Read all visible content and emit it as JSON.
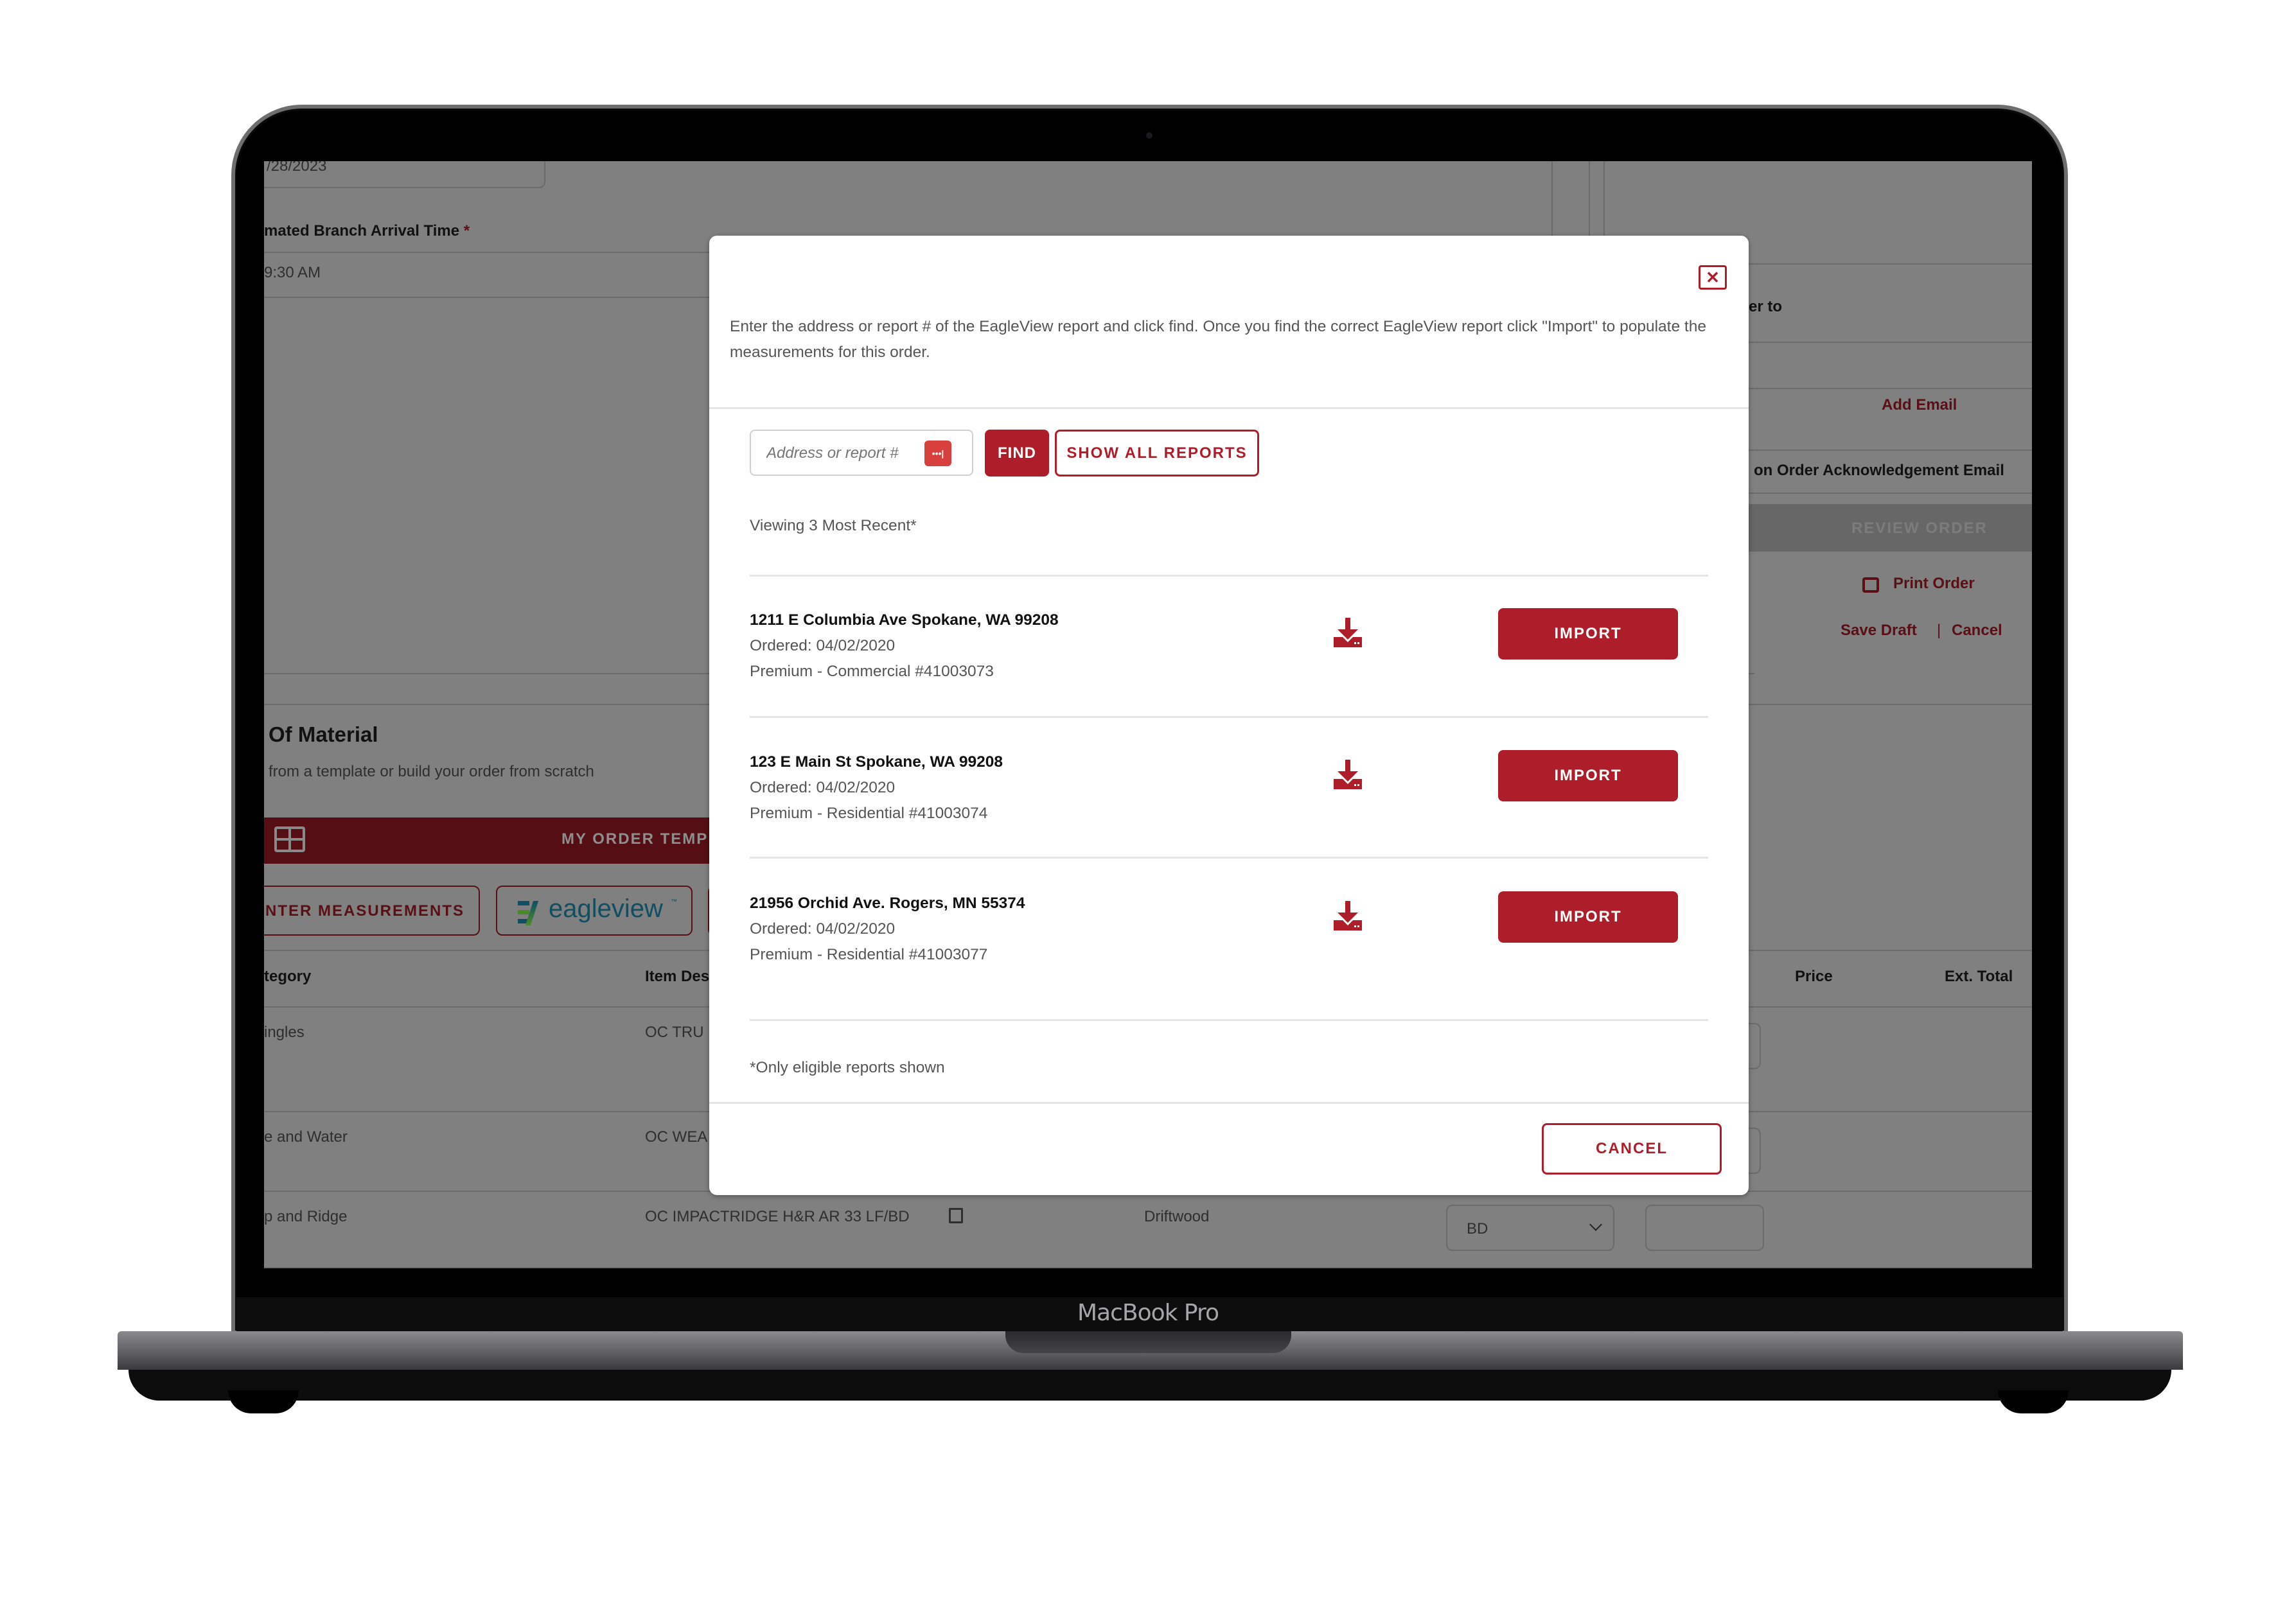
{
  "device": {
    "brand_label": "MacBook Pro"
  },
  "background_page": {
    "date_field_value": "/28/2023",
    "arrival_time_label": "mated Branch Arrival Time",
    "required_marker": "*",
    "arrival_time_value": "9:30 AM",
    "section_title": "Of Material",
    "section_subtitle": "from a template or build your order from scratch",
    "template_bar_label": "MY ORDER TEMP",
    "enter_measurements_label": "NTER MEASUREMENTS",
    "eagleview_logo_text": "eagleview",
    "eagleview_tm": "™",
    "table_headers": {
      "category": "tegory",
      "item_description": "Item Des",
      "price": "Price",
      "ext_total": "Ext. Total"
    },
    "table_rows": [
      {
        "category": "ingles",
        "item": "OC TRU"
      },
      {
        "category": "e and Water",
        "item": "OC WEA"
      },
      {
        "category": "p and Ridge",
        "item": "OC IMPACTRIDGE H&R AR 33 LF/BD",
        "color": "Driftwood",
        "uom": "BD"
      }
    ],
    "right_panel": {
      "order_to_label": "er to",
      "add_email_link": "Add Email",
      "ack_email_label": "on Order Acknowledgement Email",
      "review_order_button": "REVIEW ORDER",
      "print_order_link": "Print Order",
      "save_draft_link": "Save Draft",
      "link_separator": "|",
      "cancel_link": "Cancel"
    }
  },
  "modal": {
    "instructions": "Enter the address or report # of the EagleView report and click find.  Once you find the correct EagleView report click \"Import\" to populate the measurements for this order.",
    "search": {
      "placeholder": "Address or report #",
      "value": ""
    },
    "find_button": "FIND",
    "show_all_button": "SHOW ALL REPORTS",
    "viewing_label": "Viewing 3 Most Recent*",
    "reports": [
      {
        "address": "1211 E Columbia Ave Spokane, WA 99208",
        "ordered": "Ordered: 04/02/2020",
        "product": "Premium - Commercial #41003073",
        "import_label": "IMPORT"
      },
      {
        "address": "123 E Main St Spokane, WA 99208",
        "ordered": "Ordered: 04/02/2020",
        "product": "Premium - Residential #41003074",
        "import_label": "IMPORT"
      },
      {
        "address": "21956 Orchid Ave. Rogers, MN 55374",
        "ordered": "Ordered: 04/02/2020",
        "product": "Premium - Residential #41003077",
        "import_label": "IMPORT"
      }
    ],
    "footnote": "*Only eligible reports shown",
    "cancel_button": "CANCEL",
    "close_icon": "close-x-icon",
    "download_icon": "download-tray-icon",
    "password_manager_icon": "password-dots-icon"
  },
  "colors": {
    "brand_red": "#ad1e2a",
    "overlay_gray": "#808080",
    "muted_text": "#555555"
  }
}
